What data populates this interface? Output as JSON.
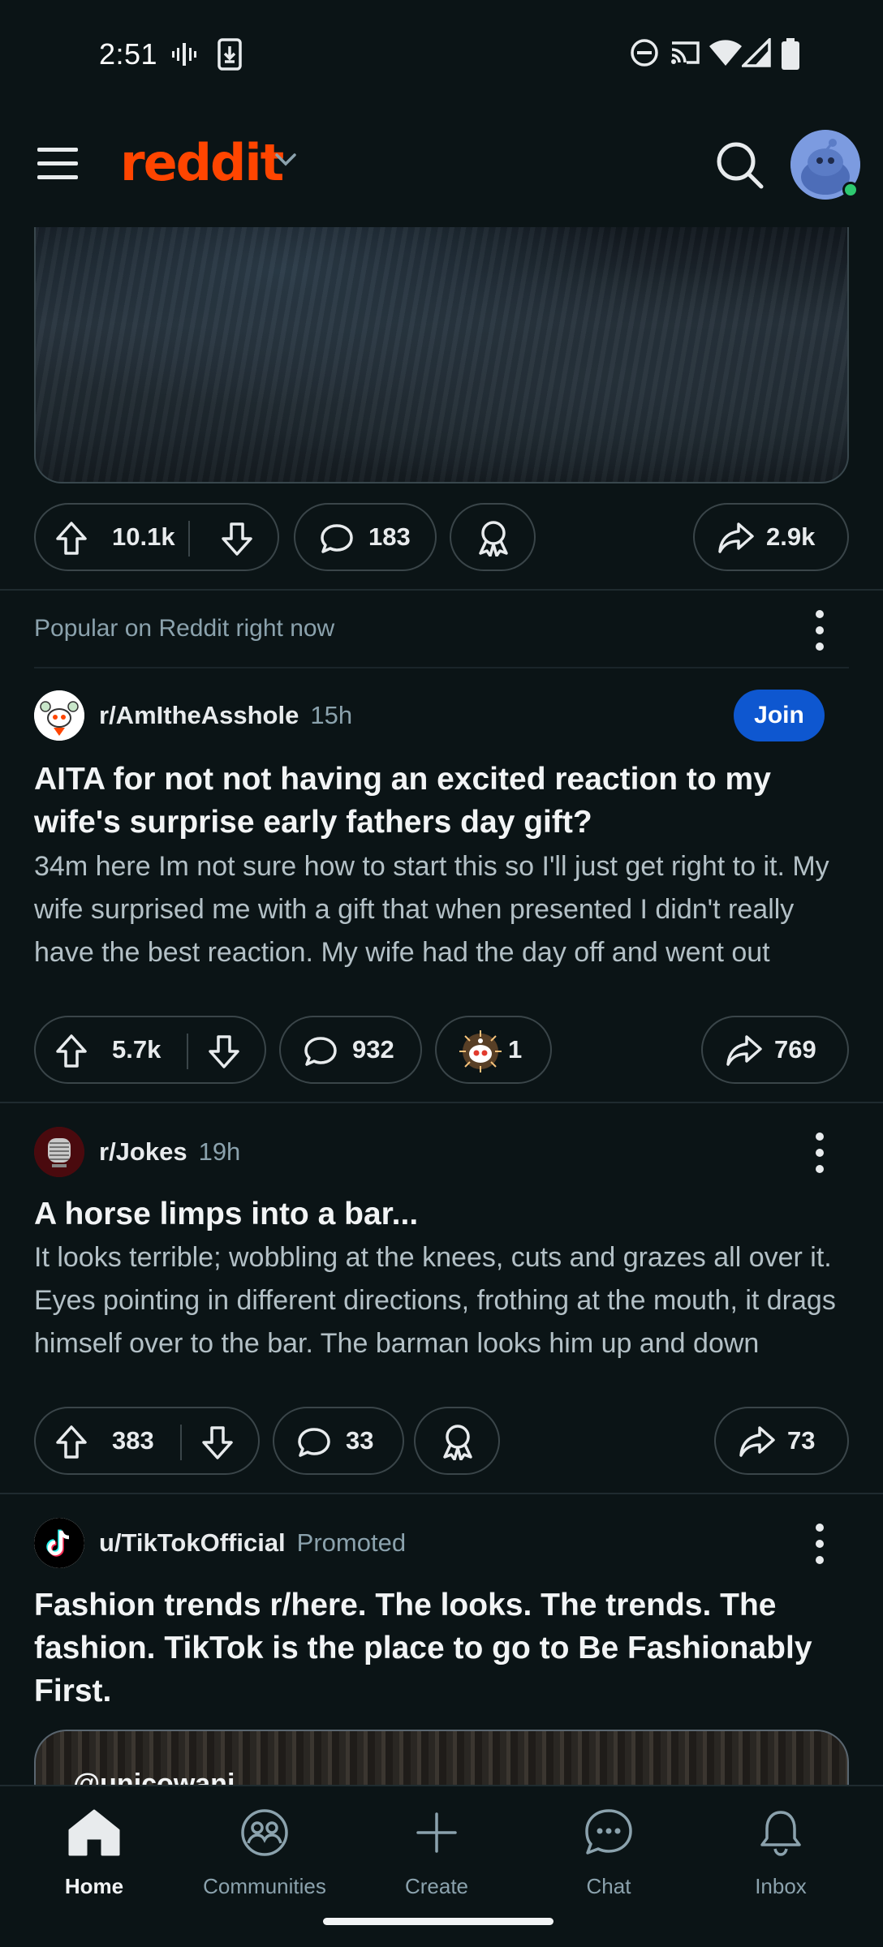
{
  "status_bar": {
    "time": "2:51"
  },
  "app_bar": {
    "logo": "reddit"
  },
  "top_post_actions": {
    "upvotes": "10.1k",
    "comments": "183",
    "shares": "2.9k"
  },
  "popular_header": "Popular on Reddit right now",
  "posts": [
    {
      "subreddit": "r/AmItheAsshole",
      "time": "15h",
      "join_label": "Join",
      "title": "AITA for not not having an excited reaction to my wife's surprise early fathers day gift?",
      "body": "34m here Im not sure how to start this so I'll just get right to it. My wife surprised me with a gift that when presented I didn't really have the best reaction. My wife had the day off and went out",
      "upvotes": "5.7k",
      "comments": "932",
      "awards": "1",
      "shares": "769"
    },
    {
      "subreddit": "r/Jokes",
      "time": "19h",
      "title": "A horse limps into a bar...",
      "body": "It looks terrible; wobbling at the knees, cuts and grazes all over it. Eyes pointing in different directions, frothing at the mouth, it drags himself over to the bar. The barman looks him up and down",
      "upvotes": "383",
      "comments": "33",
      "shares": "73"
    },
    {
      "author": "u/TikTokOfficial",
      "promoted_label": "Promoted",
      "title": "Fashion trends r/here. The looks. The trends. The fashion. TikTok is the place to go to Be Fashionably First.",
      "media_handle": "@unicowani"
    }
  ],
  "bottom_nav": [
    {
      "label": "Home",
      "icon": "home-icon",
      "active": true
    },
    {
      "label": "Communities",
      "icon": "communities-icon"
    },
    {
      "label": "Create",
      "icon": "plus-icon"
    },
    {
      "label": "Chat",
      "icon": "chat-icon"
    },
    {
      "label": "Inbox",
      "icon": "bell-icon"
    }
  ],
  "colors": {
    "brand": "#ff4500",
    "join": "#0e57d0",
    "background": "#0b1416",
    "online": "#2ec970"
  }
}
